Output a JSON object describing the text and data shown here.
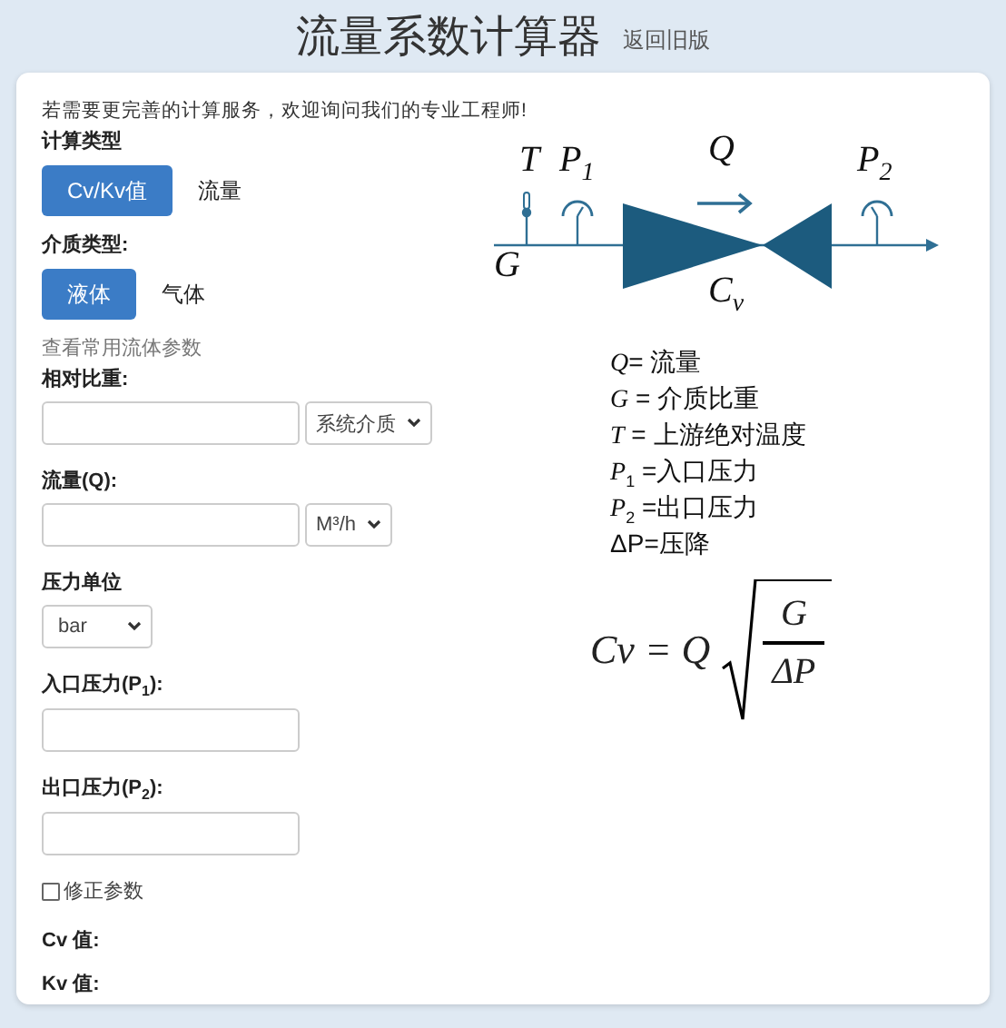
{
  "header": {
    "title": "流量系数计算器",
    "link": "返回旧版"
  },
  "notice": "若需要更完善的计算服务，欢迎询问我们的专业工程师!",
  "calc_type": {
    "label": "计算类型",
    "options": [
      {
        "label": "Cv/Kv值",
        "selected": true
      },
      {
        "label": "流量",
        "selected": false
      }
    ]
  },
  "medium_type": {
    "label": "介质类型:",
    "options": [
      {
        "label": "液体",
        "selected": true
      },
      {
        "label": "气体",
        "selected": false
      }
    ]
  },
  "fluid_link": "查看常用流体参数",
  "fields": [
    {
      "kind": "input_select",
      "label": "相对比重:",
      "select": "系统介质"
    },
    {
      "kind": "input_select",
      "label": "流量(Q):",
      "select": "M³/h"
    },
    {
      "kind": "select",
      "label": "压力单位",
      "select": "bar"
    },
    {
      "kind": "input",
      "label": "入口压力(P$_{1}$):"
    },
    {
      "kind": "input",
      "label": "出口压力(P$_{2}$):"
    }
  ],
  "correction": {
    "label": "修正参数",
    "checked": false
  },
  "results": [
    "Cv 值:",
    "Kv 值:"
  ],
  "diagram": {
    "labels": [
      {
        "kind": "T",
        "text": "*T*"
      },
      {
        "kind": "P1",
        "text": "*P*$_{1}$"
      },
      {
        "kind": "Q",
        "text": "*Q*"
      },
      {
        "kind": "P2",
        "text": "*P*$_{2}$"
      },
      {
        "kind": "G",
        "text": "*G*"
      },
      {
        "kind": "Cv",
        "text": "*C*$_{v}$"
      }
    ]
  },
  "legend": [
    "*Q*= 流量",
    "*G* = 介质比重",
    "*T* = 上游绝对温度",
    "*P*$_{1}$ =入口压力",
    "*P*$_{2}$ =出口压力",
    "ΔP=压降"
  ],
  "formula": {
    "lhs": "Cv = Q",
    "numerator": "G",
    "denominator": "ΔP"
  }
}
